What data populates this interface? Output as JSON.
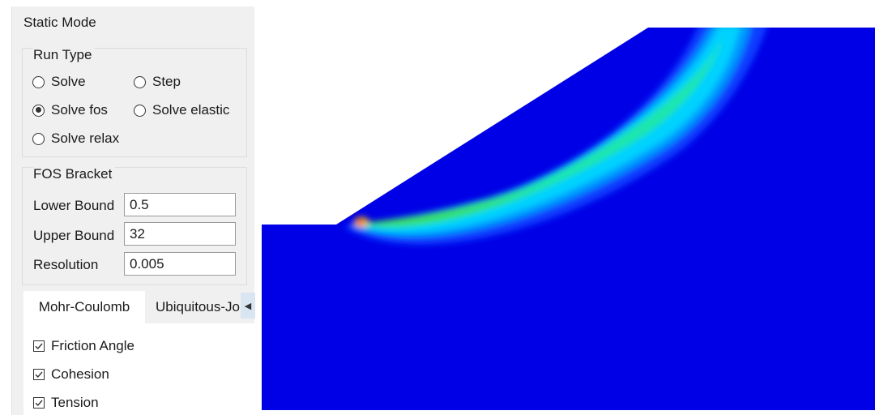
{
  "panel": {
    "title": "Static Mode",
    "run_type": {
      "title": "Run Type",
      "options": [
        {
          "label": "Solve",
          "selected": false
        },
        {
          "label": "Step",
          "selected": false
        },
        {
          "label": "Solve fos",
          "selected": true
        },
        {
          "label": "Solve elastic",
          "selected": false
        },
        {
          "label": "Solve relax",
          "selected": false
        }
      ]
    },
    "fos_bracket": {
      "title": "FOS Bracket",
      "lower_label": "Lower Bound",
      "lower_value": "0.5",
      "upper_label": "Upper Bound",
      "upper_value": "32",
      "resolution_label": "Resolution",
      "resolution_value": "0.005"
    },
    "tabs": {
      "active": "Mohr-Coulomb",
      "inactive": "Ubiquitous-Jo",
      "scroll_icon": "triangle-left-icon"
    },
    "checks": [
      {
        "label": "Friction Angle",
        "checked": true
      },
      {
        "label": "Cohesion",
        "checked": true
      },
      {
        "label": "Tension",
        "checked": true
      }
    ]
  },
  "plot": {
    "background_color": "#0000e6",
    "band_colors": [
      "#0a3cff",
      "#0096ff",
      "#00d2ff",
      "#1ee6aa",
      "#3cdc3c",
      "#ffd200",
      "#ff2000"
    ]
  }
}
